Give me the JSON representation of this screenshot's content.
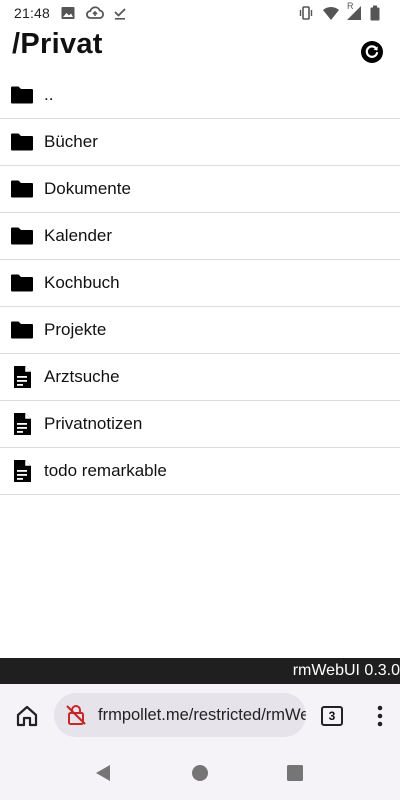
{
  "status_bar": {
    "time": "21:48",
    "left_icons": [
      "image-icon",
      "cloud-upload-icon",
      "download-done-icon"
    ],
    "right_icons": [
      "vibrate-icon",
      "wifi-icon",
      "signal-roaming-icon",
      "battery-icon"
    ],
    "roaming_label": "R"
  },
  "header": {
    "title": "/Privat",
    "refresh_icon": "refresh-icon"
  },
  "items": [
    {
      "label": "..",
      "type": "folder"
    },
    {
      "label": "Bücher",
      "type": "folder"
    },
    {
      "label": "Dokumente",
      "type": "folder"
    },
    {
      "label": "Kalender",
      "type": "folder"
    },
    {
      "label": "Kochbuch",
      "type": "folder"
    },
    {
      "label": "Projekte",
      "type": "folder"
    },
    {
      "label": "Arztsuche",
      "type": "document"
    },
    {
      "label": "Privatnotizen",
      "type": "document"
    },
    {
      "label": "todo remarkable",
      "type": "document"
    }
  ],
  "footer": {
    "text": "rmWebUI 0.3.0"
  },
  "browser": {
    "url": "frmpollet.me/restricted/rmWebUI",
    "tab_count": "3",
    "home_icon": "home-icon",
    "lock_icon": "not-secure-lock-icon",
    "menu_icon": "more-vert-icon"
  },
  "nav": {
    "back_icon": "back-icon",
    "home_icon": "home-circle-icon",
    "recents_icon": "recents-icon"
  }
}
